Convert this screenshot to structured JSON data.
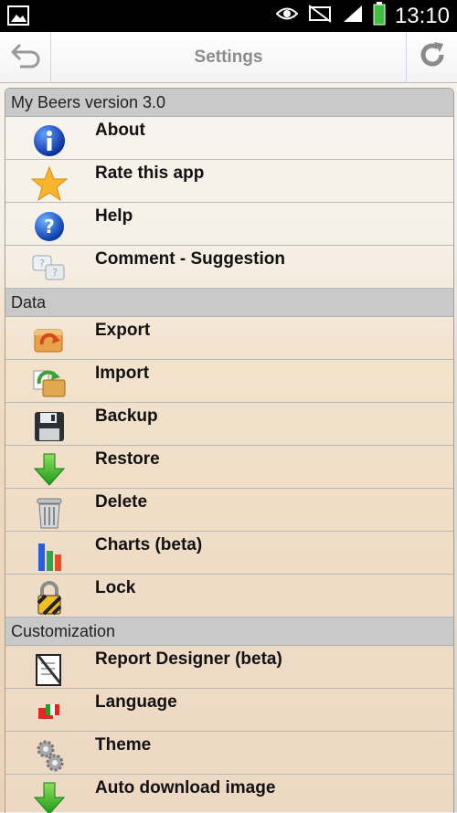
{
  "status": {
    "time": "13:10"
  },
  "header": {
    "title": "Settings"
  },
  "sections": [
    {
      "title": "My Beers version 3.0",
      "items": [
        {
          "label": "About",
          "icon": "info-icon"
        },
        {
          "label": "Rate this app",
          "icon": "star-icon"
        },
        {
          "label": "Help",
          "icon": "help-icon"
        },
        {
          "label": "Comment - Suggestion",
          "icon": "chat-icon"
        }
      ]
    },
    {
      "title": "Data",
      "items": [
        {
          "label": "Export",
          "icon": "export-icon"
        },
        {
          "label": "Import",
          "icon": "import-icon"
        },
        {
          "label": "Backup",
          "icon": "floppy-icon"
        },
        {
          "label": "Restore",
          "icon": "down-arrow-icon"
        },
        {
          "label": "Delete",
          "icon": "trash-icon"
        },
        {
          "label": "Charts (beta)",
          "icon": "chart-icon"
        },
        {
          "label": "Lock",
          "icon": "lock-icon"
        }
      ]
    },
    {
      "title": "Customization",
      "items": [
        {
          "label": "Report Designer (beta)",
          "icon": "report-icon"
        },
        {
          "label": "Language",
          "icon": "flags-icon"
        },
        {
          "label": "Theme",
          "icon": "gears-icon"
        },
        {
          "label": "Auto download image",
          "icon": "download-icon"
        }
      ]
    }
  ]
}
